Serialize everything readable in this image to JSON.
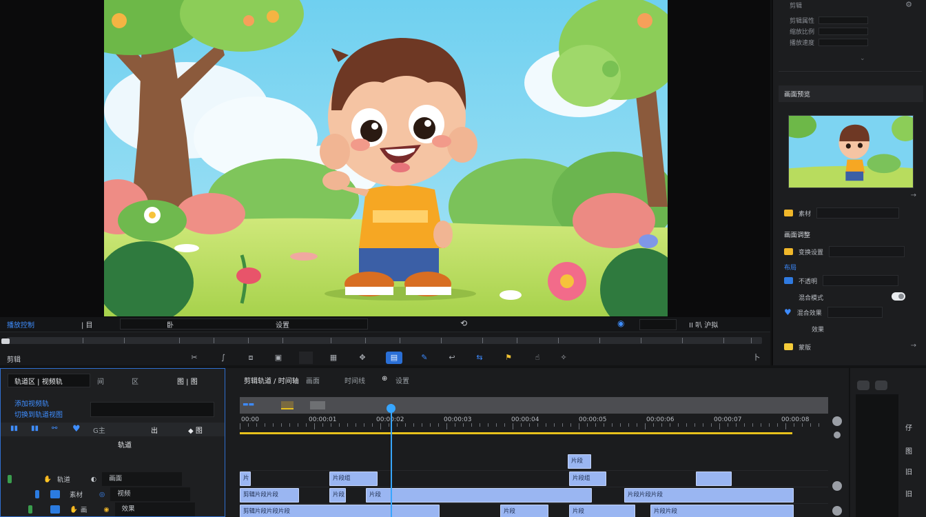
{
  "viewer": {
    "scene_description_icon": "cartoon-boy-scene"
  },
  "inspector": {
    "top_rows": [
      "剪辑",
      "剪辑属性",
      "缩放比例",
      "播放速度"
    ],
    "preview_title": "画面预览",
    "props": {
      "source_label": "素材",
      "section2_title": "画面调整",
      "transform_label": "变换设置",
      "layout_label": "布局",
      "opacity_label": "不透明",
      "mode_label": "混合模式",
      "effect_label": "混合效果",
      "effect_value": "效果",
      "mask_label": "蒙版"
    }
  },
  "transport": {
    "left_title": "播放控制",
    "counter": "| 目",
    "mid_mark": "卧",
    "right_mark": "设置",
    "center_icon": "loop-icon",
    "right_labels": "II 叭 沪拟",
    "edit_label": "剪辑",
    "marker_label": "卜"
  },
  "timeline": {
    "left_tabs": [
      "轨道区 | 视频轨",
      "间",
      "区",
      "图 | 图"
    ],
    "sub_labels": [
      "添加视频轨",
      "切换到轨道视图"
    ],
    "icons_row_text": "G主",
    "icons_row_text2": "出",
    "track_header": "轨道",
    "tracks": [
      {
        "name": "轨道",
        "label": "画面",
        "color": "#3a9d4d"
      },
      {
        "name": "素材",
        "label": "视频",
        "color": "#2b7be0"
      },
      {
        "name": "画",
        "label": "效果",
        "color": "#2b7be0"
      }
    ],
    "right_tabs": [
      "剪辑轨道 / 时间轴",
      "画面",
      "时间线",
      "设置"
    ],
    "ruler_labels": [
      "00:00",
      "00:00:01",
      "00:00:02",
      "00:00:03",
      "00:00:04",
      "00:00:05",
      "00:00:06",
      "00:00:07",
      "00:00:08"
    ],
    "clips_row0": [
      {
        "label": "片段",
        "start": 476,
        "width": 34
      }
    ],
    "clips_row1": [
      {
        "label": "片",
        "start": 0,
        "width": 16
      },
      {
        "label": "片段组",
        "start": 130,
        "width": 70
      },
      {
        "label": "片段组",
        "start": 478,
        "width": 54
      },
      {
        "label": "",
        "start": 662,
        "width": 52
      }
    ],
    "clips_row2": [
      {
        "label": "剪辑片段片段",
        "start": 0,
        "width": 86
      },
      {
        "label": "片段",
        "start": 130,
        "width": 24
      },
      {
        "label": "片段",
        "start": 183,
        "width": 328
      },
      {
        "label": "片段片段片段",
        "start": 558,
        "width": 246
      }
    ],
    "clips_row3": [
      {
        "label": "剪辑片段片段片段",
        "start": 0,
        "width": 290
      },
      {
        "label": "片段",
        "start": 378,
        "width": 70
      },
      {
        "label": "片段",
        "start": 478,
        "width": 96
      },
      {
        "label": "片段片段",
        "start": 596,
        "width": 208
      }
    ]
  },
  "mixer": {
    "labels": [
      "仔",
      "图",
      "旧",
      "旧"
    ]
  }
}
